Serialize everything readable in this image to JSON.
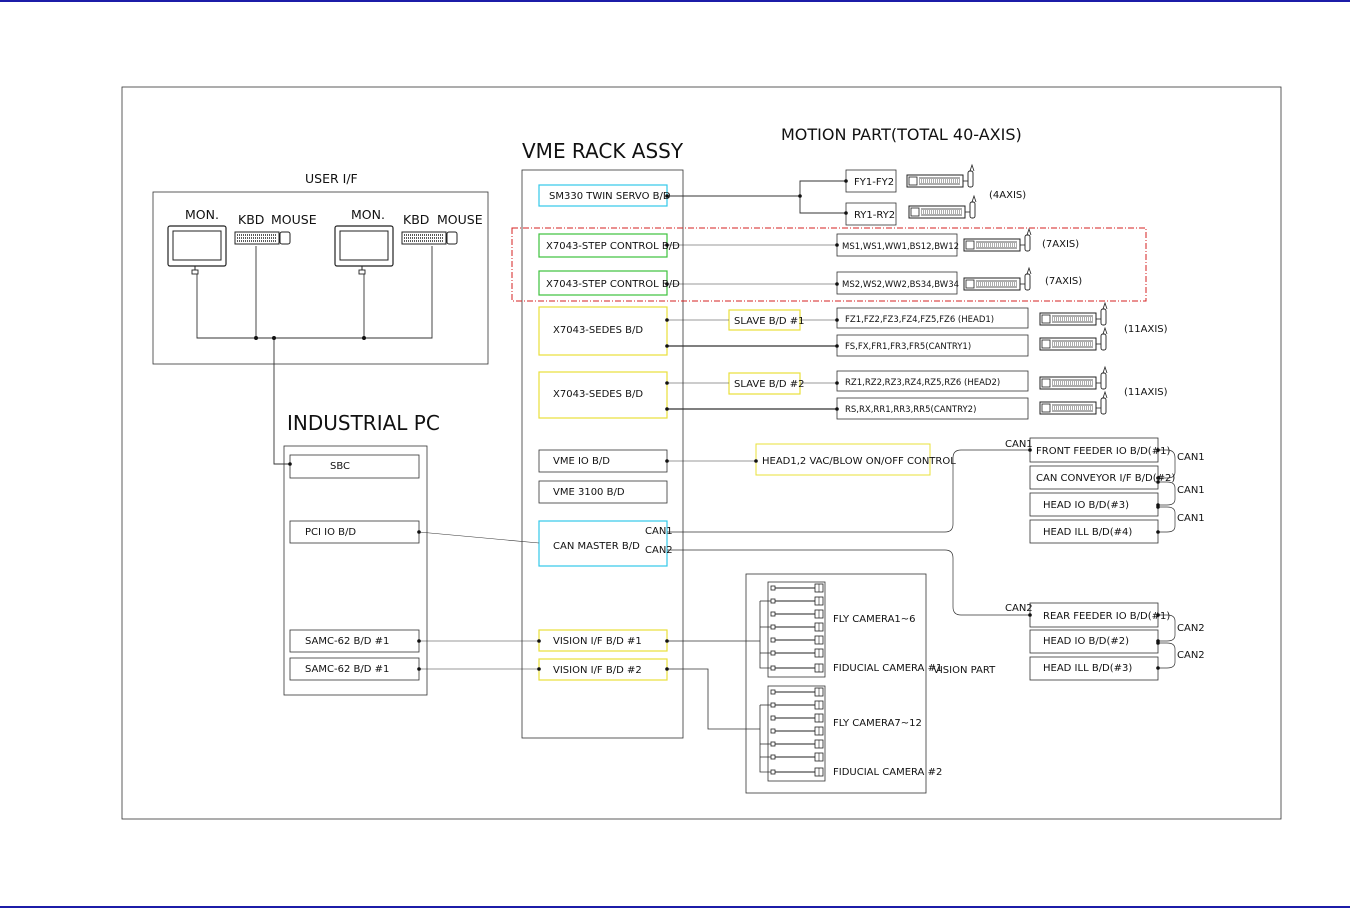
{
  "titles": {
    "vme_rack": "VME RACK ASSY",
    "motion_part": "MOTION PART(TOTAL 40-AXIS)",
    "user_if": "USER I/F",
    "industrial_pc": "INDUSTRIAL PC",
    "vision_part": "VISION PART"
  },
  "user_if": {
    "mon1": "MON.",
    "kbd1": "KBD",
    "mouse1": "MOUSE",
    "mon2": "MON.",
    "kbd2": "KBD",
    "mouse2": "MOUSE"
  },
  "pc": {
    "sbc": "SBC",
    "pci_io": "PCI IO B/D",
    "samc1": "SAMC-62 B/D #1",
    "samc2": "SAMC-62 B/D #1"
  },
  "rack": {
    "sm330": "SM330 TWIN SERVO B/D",
    "step1": "X7043-STEP CONTROL B/D",
    "step2": "X7043-STEP CONTROL B/D",
    "sedes1": "X7043-SEDES B/D",
    "sedes2": "X7043-SEDES B/D",
    "vme_io": "VME IO B/D",
    "vme3100": "VME 3100 B/D",
    "can_master": "CAN MASTER B/D",
    "can1_port": "CAN1",
    "can2_port": "CAN2",
    "vision1": "VISION I/F B/D #1",
    "vision2": "VISION I/F B/D #2"
  },
  "motion": {
    "fy": "FY1-FY2",
    "ry": "RY1-RY2",
    "axis4": "(4AXIS)",
    "ms1": "MS1,WS1,WW1,BS12,BW12",
    "ms2": "MS2,WS2,WW2,BS34,BW34",
    "axis7a": "(7AXIS)",
    "axis7b": "(7AXIS)",
    "slave1": "SLAVE B/D #1",
    "slave2": "SLAVE B/D #2",
    "fz": "FZ1,FZ2,FZ3,FZ4,FZ5,FZ6 (HEAD1)",
    "fs": "FS,FX,FR1,FR3,FR5(CANTRY1)",
    "rz": "RZ1,RZ2,RZ3,RZ4,RZ5,RZ6 (HEAD2)",
    "rs": "RS,RX,RR1,RR3,RR5(CANTRY2)",
    "axis11a": "(11AXIS)",
    "axis11b": "(11AXIS)",
    "vac": "HEAD1,2 VAC/BLOW ON/OFF CONTROL"
  },
  "can1": {
    "label_top": "CAN1",
    "n1": "FRONT FEEDER IO B/D(#1)",
    "n2": "CAN CONVEYOR I/F B/D(#2)",
    "n3": "HEAD IO B/D(#3)",
    "n4": "HEAD ILL B/D(#4)",
    "link1": "CAN1",
    "link2": "CAN1",
    "link3": "CAN1"
  },
  "can2": {
    "label_top": "CAN2",
    "n1": "REAR FEEDER IO B/D(#1)",
    "n2": "HEAD IO B/D(#2)",
    "n3": "HEAD ILL B/D(#3)",
    "link1": "CAN2",
    "link2": "CAN2"
  },
  "vision": {
    "fly1": "FLY CAMERA1~6",
    "fid1": "FIDUCIAL CAMERA #1",
    "fly2": "FLY CAMERA7~12",
    "fid2": "FIDUCIAL CAMERA #2"
  },
  "colors": {
    "cyan": "#33c8e8",
    "green": "#3cc23c",
    "yellow": "#e8e03a",
    "red_dash": "#d42020",
    "rule_blue": "#1c1ca8"
  }
}
